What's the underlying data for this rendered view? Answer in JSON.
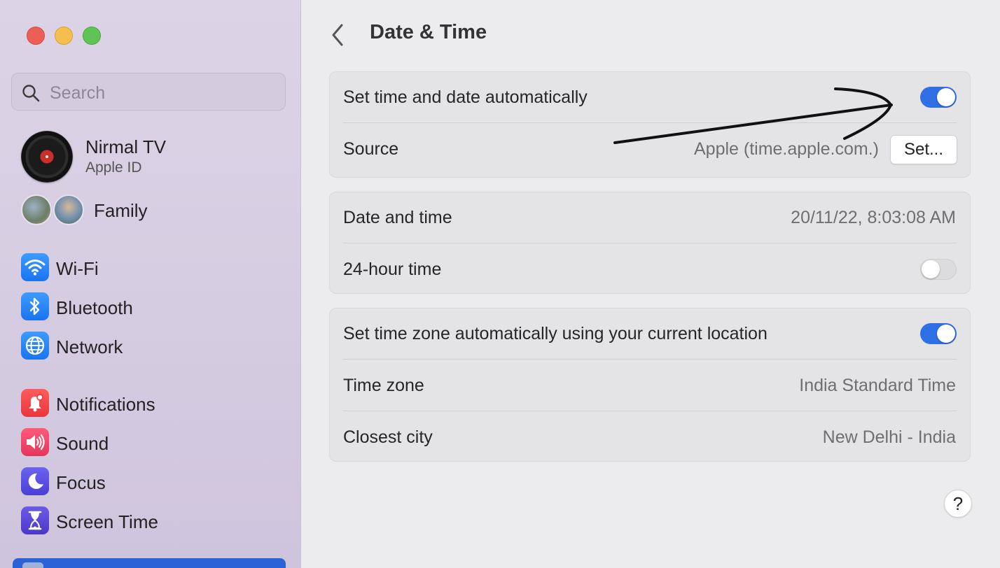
{
  "sidebar": {
    "search_placeholder": "Search",
    "profile": {
      "name": "Nirmal TV",
      "subtitle": "Apple ID"
    },
    "family_label": "Family",
    "items": [
      {
        "label": "Wi-Fi",
        "icon": "wifi-icon"
      },
      {
        "label": "Bluetooth",
        "icon": "bluetooth-icon"
      },
      {
        "label": "Network",
        "icon": "globe-icon"
      },
      {
        "label": "Notifications",
        "icon": "bell-icon"
      },
      {
        "label": "Sound",
        "icon": "speaker-icon"
      },
      {
        "label": "Focus",
        "icon": "moon-icon"
      },
      {
        "label": "Screen Time",
        "icon": "hourglass-icon"
      }
    ]
  },
  "main": {
    "title": "Date & Time",
    "rows": {
      "auto_time": {
        "label": "Set time and date automatically",
        "enabled": true
      },
      "source": {
        "label": "Source",
        "value": "Apple (time.apple.com.)",
        "button": "Set..."
      },
      "date_time": {
        "label": "Date and time",
        "value": "20/11/22, 8:03:08 AM"
      },
      "hour24": {
        "label": "24-hour time",
        "enabled": false
      },
      "auto_timezone": {
        "label": "Set time zone automatically using your current location",
        "enabled": true
      },
      "time_zone": {
        "label": "Time zone",
        "value": "India Standard Time"
      },
      "closest_city": {
        "label": "Closest city",
        "value": "New Delhi - India"
      }
    },
    "help_label": "?"
  },
  "colors": {
    "accent": "#2f6fe4",
    "sidebar_bg": "#d6cde2"
  }
}
